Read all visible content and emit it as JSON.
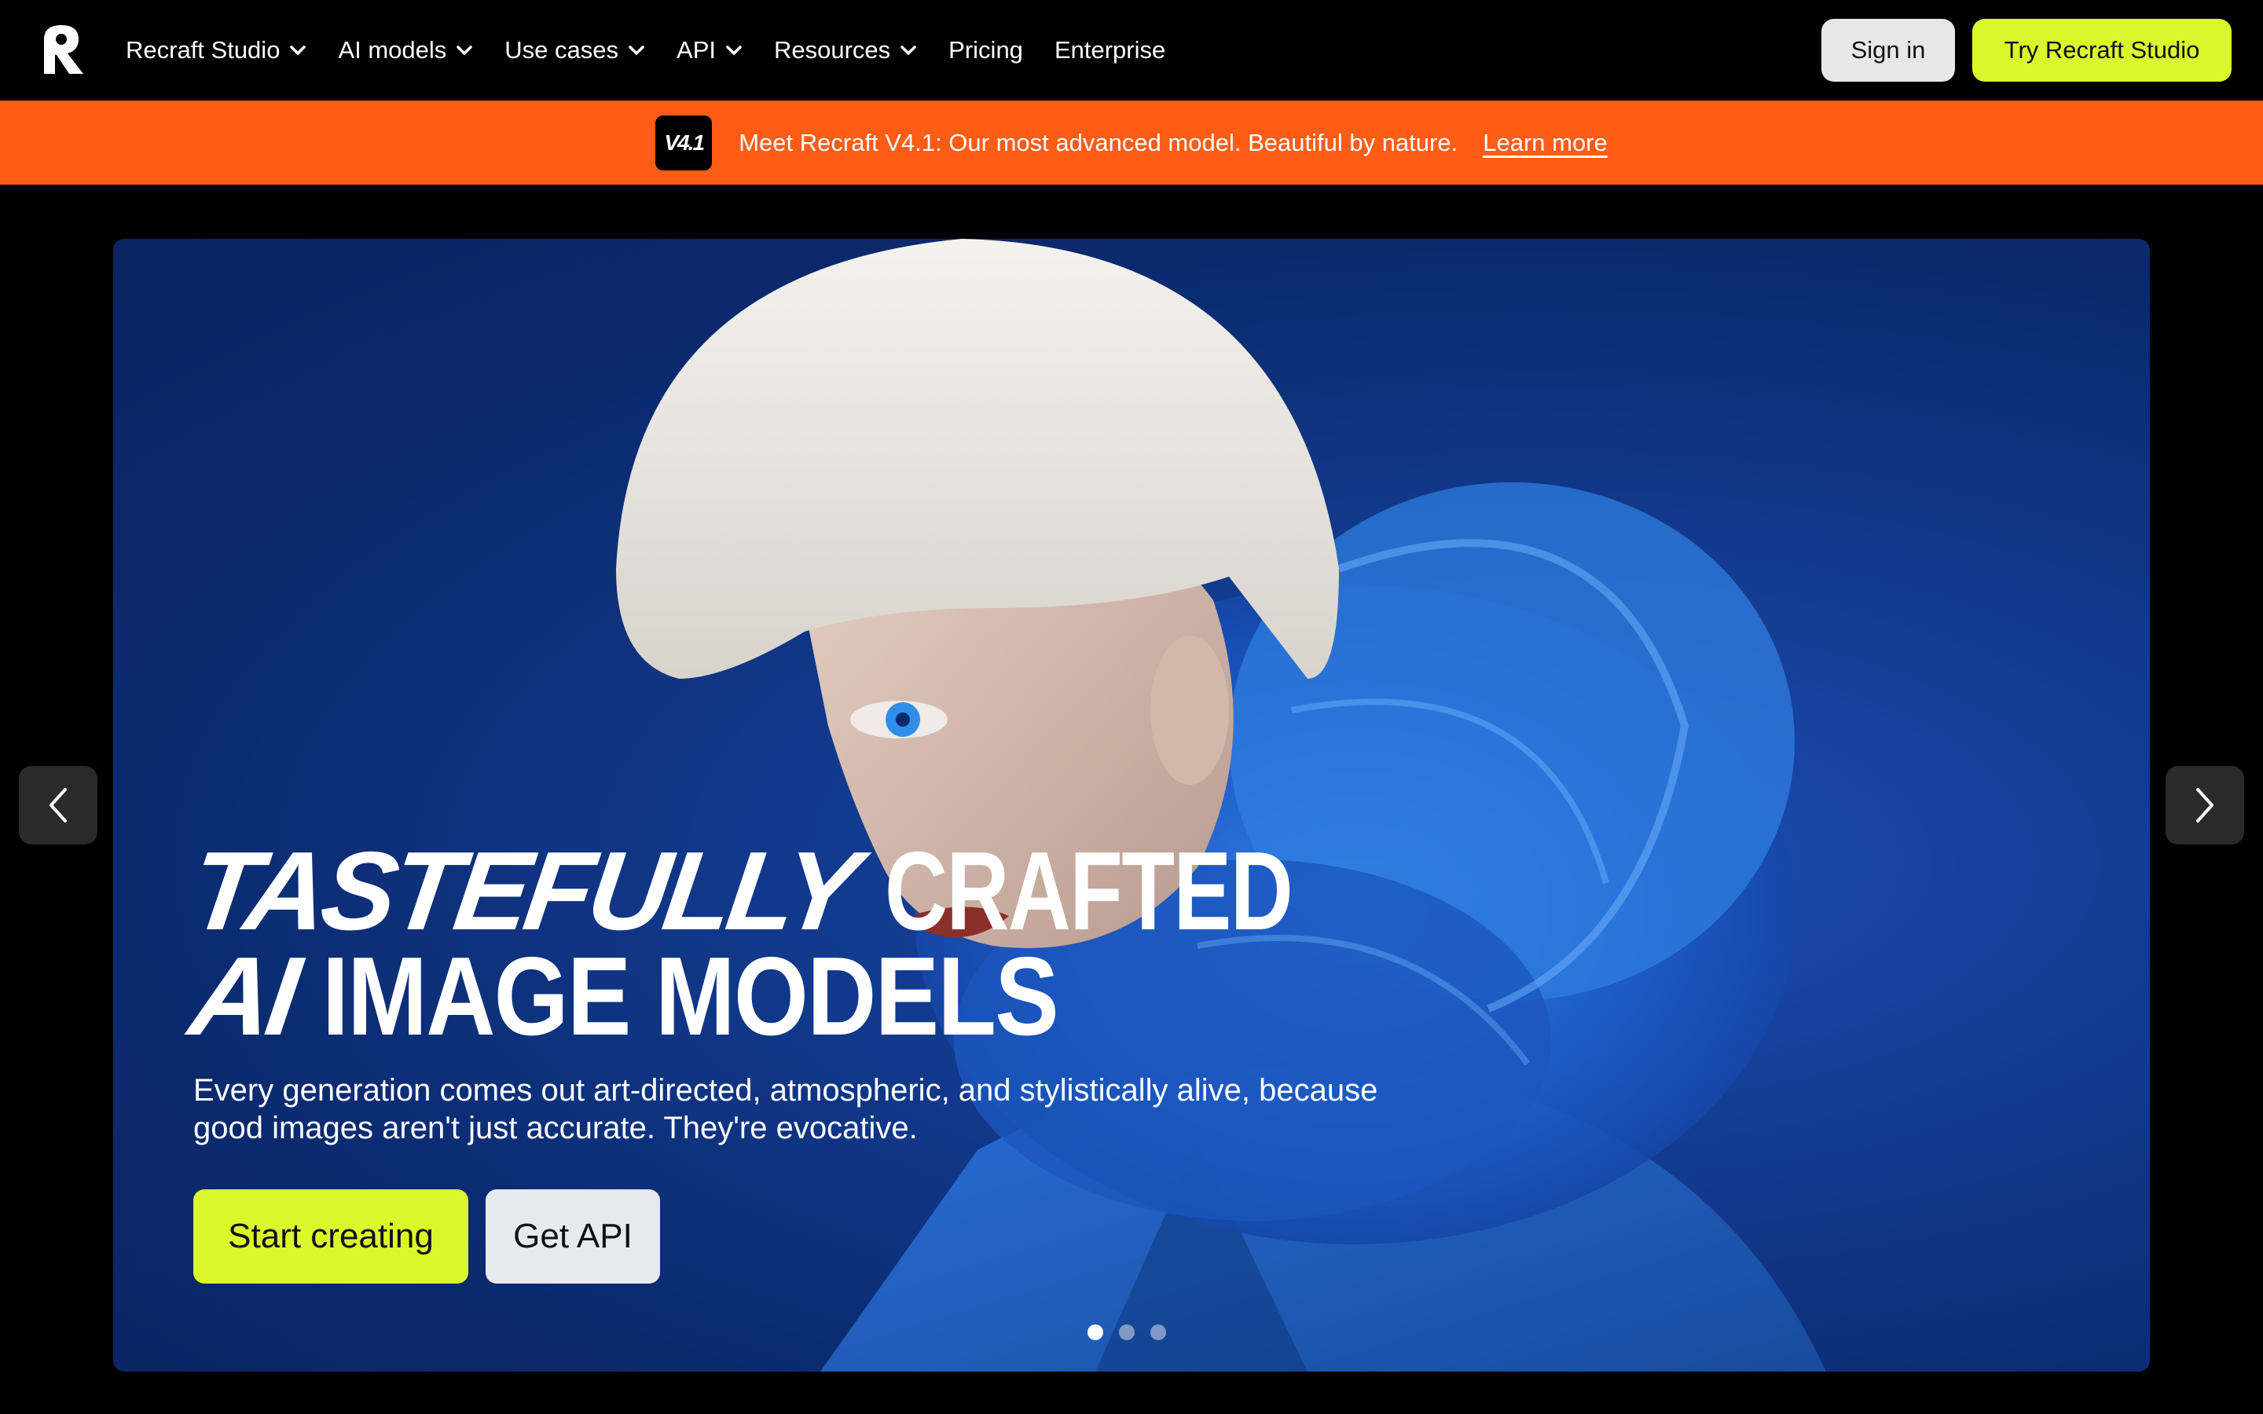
{
  "nav": {
    "logo_icon": "recraft-logo-icon",
    "items": [
      {
        "label": "Recraft Studio",
        "dropdown": true
      },
      {
        "label": "AI models",
        "dropdown": true
      },
      {
        "label": "Use cases",
        "dropdown": true
      },
      {
        "label": "API",
        "dropdown": true
      },
      {
        "label": "Resources",
        "dropdown": true
      },
      {
        "label": "Pricing",
        "dropdown": false
      },
      {
        "label": "Enterprise",
        "dropdown": false
      }
    ],
    "sign_in": "Sign in",
    "try_studio": "Try Recraft Studio"
  },
  "banner": {
    "badge": "V4.1",
    "text": "Meet Recraft V4.1: Our most advanced model. Beautiful by nature.",
    "link": "Learn more",
    "color": "#ff5c16"
  },
  "hero": {
    "headline": {
      "line1_italic": "TASTEFULLY",
      "line1_condensed": "CRAFTED",
      "line2_italic": "AI",
      "line2_wide": "IMAGE MODELS"
    },
    "subtitle": "Every generation comes out art-directed, atmospheric, and stylistically alive, because good images aren't just accurate. They're evocative.",
    "primary_button": "Start creating",
    "secondary_button": "Get API",
    "slides": {
      "count": 3,
      "active": 1
    },
    "accent_color": "#d9f72b"
  }
}
